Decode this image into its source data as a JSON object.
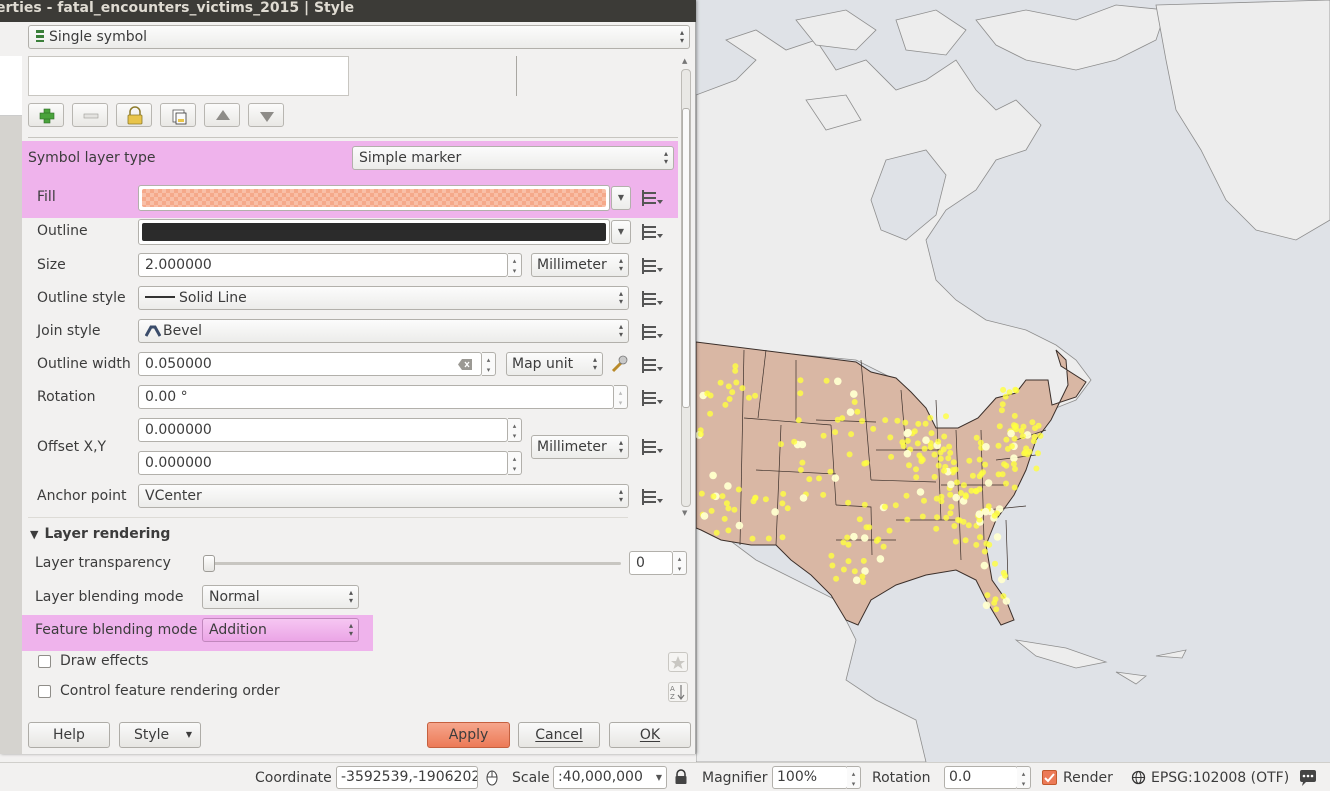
{
  "window": {
    "title": "erties - fatal_encounters_victims_2015 | Style"
  },
  "renderer": {
    "selected": "Single symbol"
  },
  "symbol_layer": {
    "type_label": "Symbol layer type",
    "type_value": "Simple marker",
    "fill_label": "Fill",
    "fill_color": "#f5a98a",
    "outline_label": "Outline",
    "outline_color": "#2b2b2b",
    "size_label": "Size",
    "size_value": "2.000000",
    "size_unit": "Millimeter",
    "outline_style_label": "Outline style",
    "outline_style_value": "Solid Line",
    "join_style_label": "Join style",
    "join_style_value": "Bevel",
    "outline_width_label": "Outline width",
    "outline_width_value": "0.050000",
    "outline_width_unit": "Map unit",
    "rotation_label": "Rotation",
    "rotation_value": "0.00 °",
    "offset_label": "Offset X,Y",
    "offset_x": "0.000000",
    "offset_y": "0.000000",
    "offset_unit": "Millimeter",
    "anchor_label": "Anchor point",
    "anchor_value": "VCenter"
  },
  "layer_rendering": {
    "section_label": "Layer rendering",
    "transparency_label": "Layer transparency",
    "transparency_value": "0",
    "transparency_fraction": 0,
    "layer_blending_label": "Layer blending mode",
    "layer_blending_value": "Normal",
    "feature_blending_label": "Feature blending mode",
    "feature_blending_value": "Addition",
    "draw_effects_label": "Draw effects",
    "draw_effects_checked": false,
    "control_order_label": "Control feature rendering order",
    "control_order_checked": false
  },
  "buttons": {
    "help": "Help",
    "style": "Style",
    "apply": "Apply",
    "cancel": "Cancel",
    "ok": "OK"
  },
  "statusbar": {
    "coordinate_label": "Coordinate",
    "coordinate_value": "-3592539,-1906202",
    "scale_label": "Scale",
    "scale_value": ":40,000,000",
    "magnifier_label": "Magnifier",
    "magnifier_value": "100%",
    "rotation_label": "Rotation",
    "rotation_value": "0.0",
    "render_label": "Render",
    "render_checked": true,
    "crs": "EPSG:102008 (OTF)"
  },
  "colors": {
    "highlight": "#efb3ec",
    "apply_button": "#ec7a57",
    "land_usa": "#d9b7a4",
    "land_other": "#eeeeee",
    "water": "#dfe2e7",
    "points": "#ffff40"
  }
}
